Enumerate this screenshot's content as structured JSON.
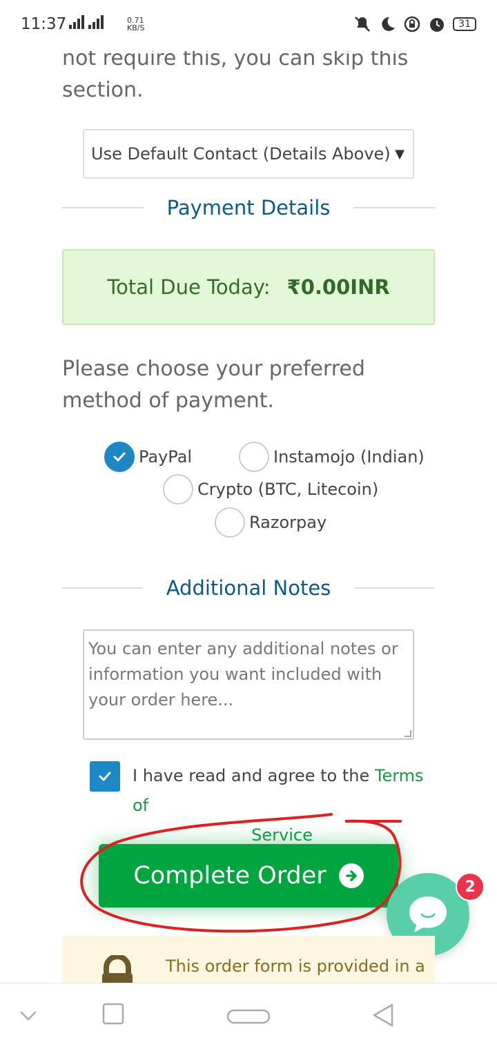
{
  "status_bar": {
    "time": "11:37",
    "net_speed_value": "0.71",
    "net_speed_unit": "KB/S",
    "battery": "31",
    "icons": [
      "mute-icon",
      "moon-icon",
      "rotation-lock-icon",
      "alarm-icon",
      "battery-icon"
    ]
  },
  "intro_text": "not require this, you can skip this section.",
  "contact_select": {
    "value": "Use Default Contact (Details Above)"
  },
  "payment_section": {
    "title": "Payment Details",
    "total_label": "Total Due Today:",
    "total_amount": "₹0.00INR",
    "choose_text": "Please choose your preferred method of payment.",
    "methods": [
      {
        "label": "PayPal",
        "checked": true
      },
      {
        "label": "Instamojo (Indian)",
        "checked": false
      },
      {
        "label": "Crypto (BTC, Litecoin)",
        "checked": false
      },
      {
        "label": "Razorpay",
        "checked": false
      }
    ]
  },
  "notes_section": {
    "title": "Additional Notes",
    "placeholder": "You can enter any additional notes or information you want included with your order here..."
  },
  "agreement": {
    "text": "I have read and agree to the",
    "link_part1": "Terms of",
    "link_part2": "Service",
    "checked": true
  },
  "complete_button": {
    "label": "Complete Order"
  },
  "chat_widget": {
    "badge_count": "2"
  },
  "notice": {
    "text": "This order form is provided in a"
  },
  "colors": {
    "accent_blue": "#1e88c7",
    "heading_blue": "#0c5a8a",
    "button_green": "#00a53f",
    "link_green": "#169b44",
    "total_bg": "#e3f8d9",
    "chat_teal": "#58cfa9",
    "badge_red": "#e8334a",
    "annotation_red": "#e02020"
  }
}
